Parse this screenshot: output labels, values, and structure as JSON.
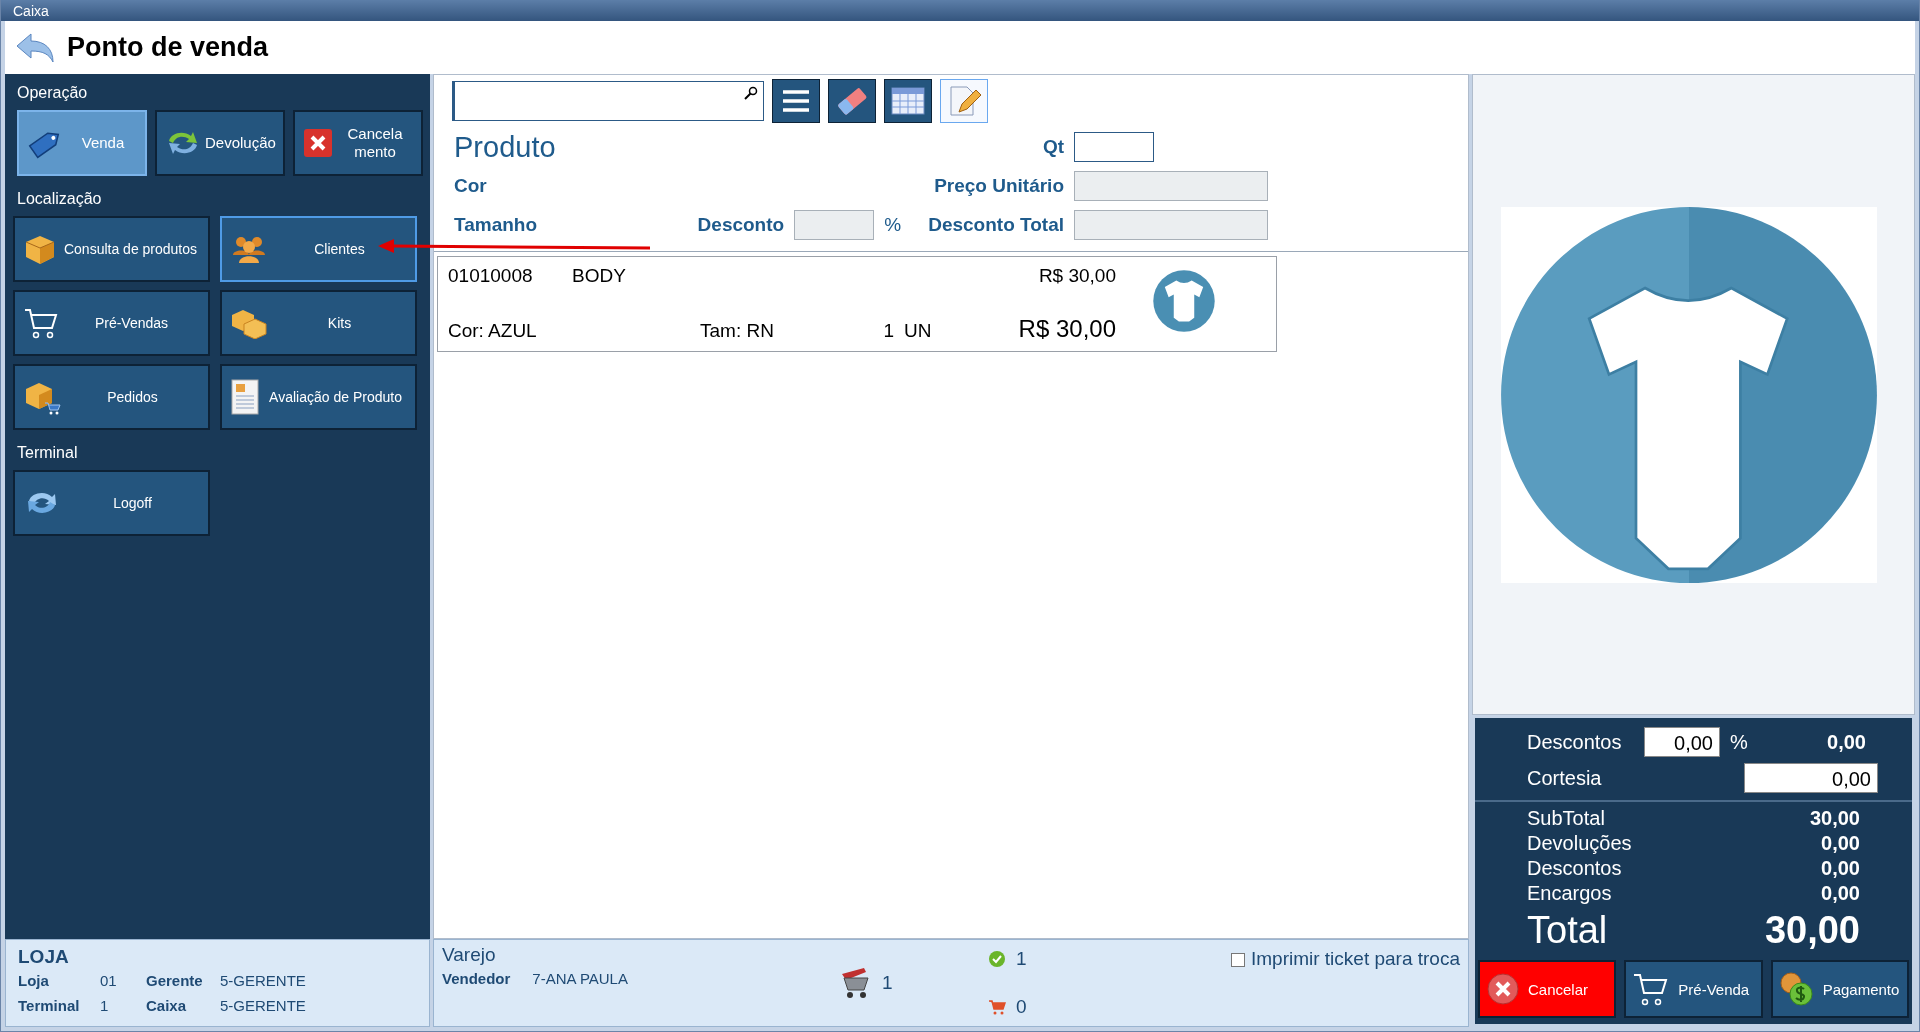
{
  "window": {
    "title": "Caixa"
  },
  "header": {
    "title": "Ponto de venda"
  },
  "sidebar": {
    "sections": [
      {
        "title": "Operação",
        "wide": false,
        "buttons": [
          {
            "label": "Venda",
            "selected": true,
            "focused": false
          },
          {
            "label": "Devolução",
            "selected": false,
            "focused": false
          },
          {
            "label": "Cancela mento",
            "selected": false,
            "focused": false
          }
        ]
      },
      {
        "title": "Localização",
        "wide": true,
        "buttons": [
          {
            "label": "Consulta de produtos",
            "selected": false,
            "focused": false
          },
          {
            "label": "Clientes",
            "selected": false,
            "focused": true
          },
          {
            "label": "Pré-Vendas",
            "selected": false,
            "focused": false
          },
          {
            "label": "Kits",
            "selected": false,
            "focused": false
          },
          {
            "label": "Pedidos",
            "selected": false,
            "focused": false
          },
          {
            "label": "Avaliação de Produto",
            "selected": false,
            "focused": false
          }
        ]
      },
      {
        "title": "Terminal",
        "wide": true,
        "buttons": [
          {
            "label": "Logoff",
            "selected": false,
            "focused": false
          }
        ]
      }
    ]
  },
  "form": {
    "title": "Produto",
    "qt_label": "Qt",
    "qt": {
      "disabled": false
    },
    "color_label": "Cor",
    "unit_price_label": "Preço Unitário",
    "unit_price": {
      "disabled": true
    },
    "size_label": "Tamanho",
    "discount_label": "Desconto",
    "discount": {
      "disabled": true
    },
    "percent": "%",
    "total_discount_label": "Desconto Total",
    "total_discount": {
      "disabled": true
    }
  },
  "items": [
    {
      "code": "01010008",
      "name": "BODY",
      "unit_price": "R$ 30,00",
      "color_info": "Cor: AZUL",
      "size": "Tam: RN",
      "quantity": "1",
      "unit": "UN",
      "total": "R$ 30,00"
    }
  ],
  "totals": {
    "discount_label": "Descontos",
    "discount_percent": "0,00",
    "percent": "%",
    "discount_value": "0,00",
    "courtesy_label": "Cortesia",
    "courtesy": "0,00",
    "summary": [
      {
        "label": "SubTotal",
        "value": "30,00"
      },
      {
        "label": "Devoluções",
        "value": "0,00"
      },
      {
        "label": "Descontos",
        "value": "0,00"
      },
      {
        "label": "Encargos",
        "value": "0,00"
      }
    ],
    "total_label": "Total",
    "total": "30,00"
  },
  "actions": [
    {
      "label": "Cancelar",
      "kind": "danger"
    },
    {
      "label": "Pré-Venda",
      "kind": "normal"
    },
    {
      "label": "Pagamento",
      "kind": "normal"
    }
  ],
  "store": {
    "title": "LOJA",
    "fields": [
      {
        "label": "Loja",
        "value": "01"
      },
      {
        "label": "Gerente",
        "value": "5-GERENTE"
      },
      {
        "label": "Terminal",
        "value": "1"
      },
      {
        "label": "Caixa",
        "value": "5-GERENTE"
      }
    ]
  },
  "sale": {
    "type": "Varejo",
    "seller_label": "Vendedor",
    "seller": "7-ANA PAULA",
    "cart_count": "1",
    "ok_count": "1",
    "pending_count": "0",
    "print_ticket": {
      "label": "Imprimir ticket para troca",
      "checked": false
    }
  }
}
